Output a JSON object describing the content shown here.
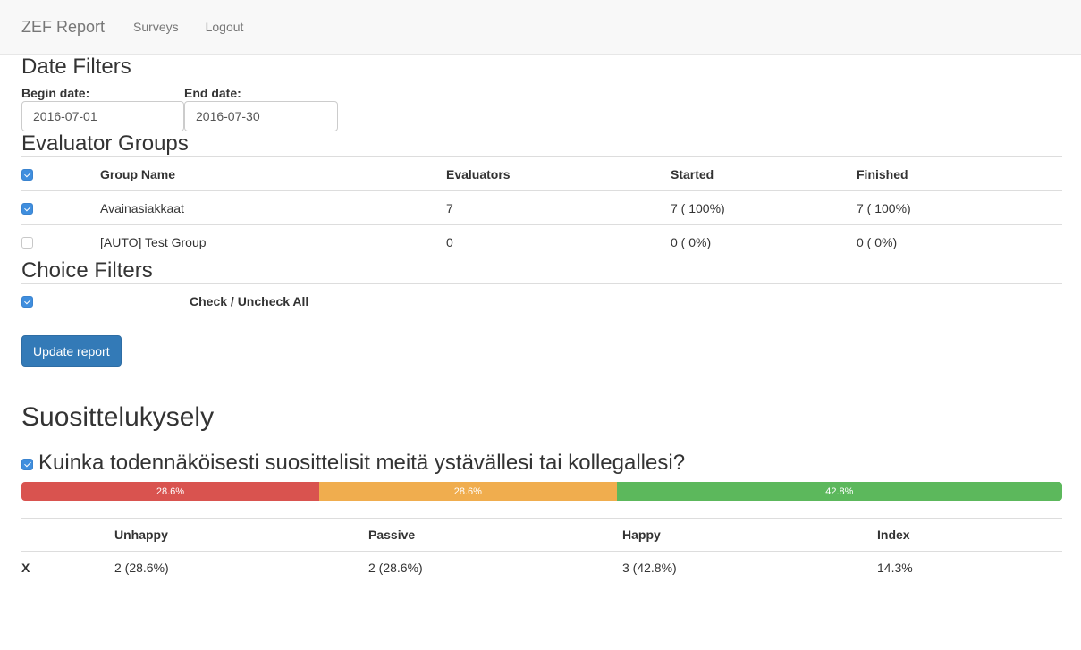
{
  "nav": {
    "brand": "ZEF Report",
    "links": [
      "Surveys",
      "Logout"
    ]
  },
  "date_filters": {
    "title": "Date Filters",
    "begin_label": "Begin date:",
    "begin_value": "2016-07-01",
    "end_label": "End date:",
    "end_value": "2016-07-30"
  },
  "evaluator_groups": {
    "title": "Evaluator Groups",
    "headers": [
      "Group Name",
      "Evaluators",
      "Started",
      "Finished"
    ],
    "header_checked": true,
    "rows": [
      {
        "checked": true,
        "name": "Avainasiakkaat",
        "evaluators": "7",
        "started": "7 ( 100%)",
        "finished": "7 ( 100%)"
      },
      {
        "checked": false,
        "name": "[AUTO] Test Group",
        "evaluators": "0",
        "started": "0 ( 0%)",
        "finished": "0 ( 0%)"
      }
    ]
  },
  "choice_filters": {
    "title": "Choice Filters",
    "checked": true,
    "toggle_label": "Check / Uncheck All"
  },
  "update_button": "Update report",
  "report": {
    "title": "Suosittelukysely",
    "question": "Kuinka todennäköisesti suosittelisit meitä ystävällesi tai kollegallesi?",
    "question_checked": true,
    "bar": [
      {
        "label": "28.6%",
        "percent": 28.6,
        "color": "#d9534f"
      },
      {
        "label": "28.6%",
        "percent": 28.6,
        "color": "#f0ad4e"
      },
      {
        "label": "42.8%",
        "percent": 42.8,
        "color": "#5cb85c"
      }
    ],
    "table": {
      "headers": [
        "Unhappy",
        "Passive",
        "Happy",
        "Index"
      ],
      "rows": [
        {
          "marker": "X",
          "unhappy": "2 (28.6%)",
          "passive": "2 (28.6%)",
          "happy": "3 (42.8%)",
          "index": "14.3%"
        }
      ]
    }
  },
  "colors": {
    "primary": "#337ab7",
    "danger": "#d9534f",
    "warning": "#f0ad4e",
    "success": "#5cb85c"
  }
}
